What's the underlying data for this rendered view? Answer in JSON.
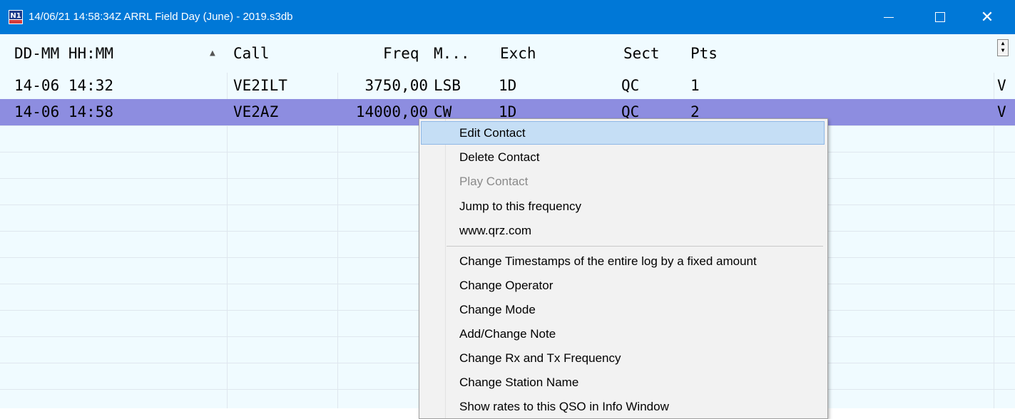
{
  "window": {
    "title": "14/06/21 14:58:34Z  ARRL Field Day (June) - 2019.s3db",
    "minimize_label": "—",
    "maximize_label": "☐",
    "close_label": "✕",
    "icon": "n1mm-logo-icon"
  },
  "log": {
    "columns": [
      "DD-MM HH:MM",
      "Call",
      "Freq",
      "M...",
      "Exch",
      "Sect",
      "Pts"
    ],
    "sorted_column": "Call",
    "sort_direction": "ascending",
    "rows": [
      {
        "datetime": "14-06 14:32",
        "call": "VE2ILT",
        "freq": "3750,00",
        "mode": "LSB",
        "exch": "1D",
        "sect": "QC",
        "pts": "1",
        "extra": "V",
        "selected": false
      },
      {
        "datetime": "14-06 14:58",
        "call": "VE2AZ",
        "freq": "14000,00",
        "mode": "CW",
        "exch": "1D",
        "sect": "QC",
        "pts": "2",
        "extra": "V",
        "selected": true
      }
    ]
  },
  "context_menu": {
    "items": [
      {
        "label": "Edit Contact",
        "state": "hover"
      },
      {
        "label": "Delete Contact",
        "state": "normal"
      },
      {
        "label": "Play Contact",
        "state": "disabled"
      },
      {
        "label": "Jump to this frequency",
        "state": "normal"
      },
      {
        "label": "www.qrz.com",
        "state": "normal"
      },
      {
        "label": "Change Timestamps of the entire log by a fixed amount",
        "state": "normal"
      },
      {
        "label": "Change Operator",
        "state": "normal"
      },
      {
        "label": "Change Mode",
        "state": "normal"
      },
      {
        "label": "Add/Change Note",
        "state": "normal"
      },
      {
        "label": "Change Rx and Tx Frequency",
        "state": "normal"
      },
      {
        "label": "Change Station Name",
        "state": "normal"
      },
      {
        "label": "Show rates to this QSO in Info Window",
        "state": "normal"
      }
    ]
  },
  "colors": {
    "titlebar": "#0078d7",
    "selected_row": "#8d8de0",
    "menu_hover": "#c5def5",
    "grid_background": "#f0fbff"
  }
}
